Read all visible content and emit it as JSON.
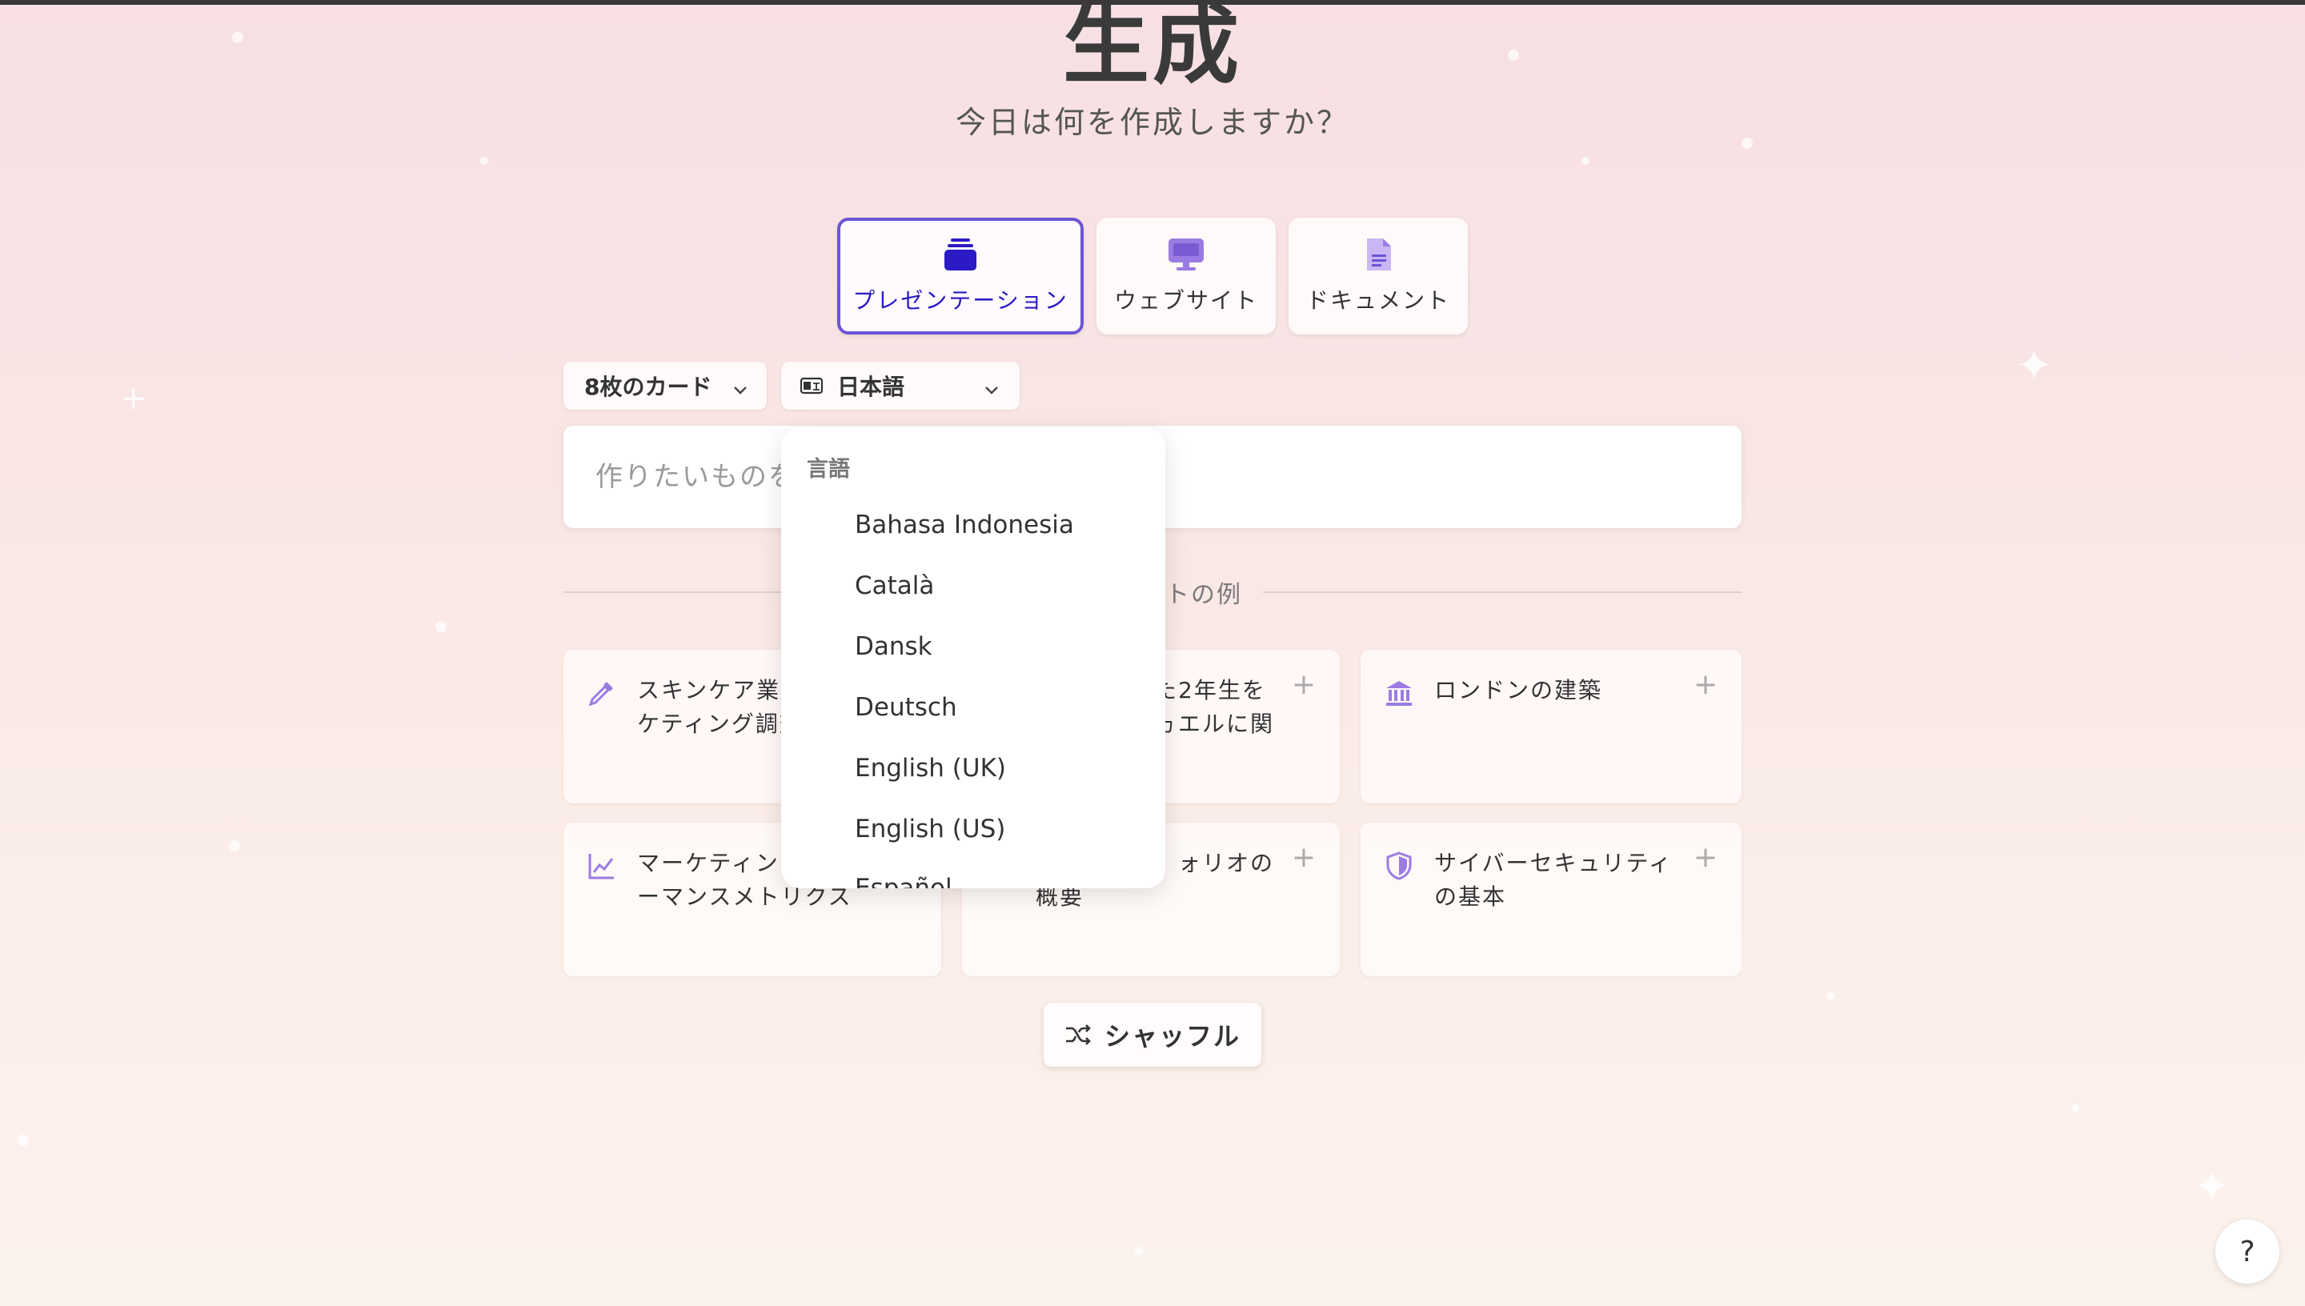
{
  "page": {
    "title": "生成",
    "subtitle": "今日は何を作成しますか？"
  },
  "types": [
    {
      "label": "プレゼンテーション",
      "icon": "slides-stack-icon",
      "selected": true
    },
    {
      "label": "ウェブサイト",
      "icon": "monitor-icon",
      "selected": false
    },
    {
      "label": "ドキュメント",
      "icon": "document-icon",
      "selected": false
    }
  ],
  "controls": {
    "cards_label": "8枚のカード",
    "language_label": "日本語"
  },
  "prompt": {
    "placeholder": "作りたいものを"
  },
  "divider": {
    "label": "トの例"
  },
  "examples": [
    {
      "text": "スキンケア業界のマーケティング調査",
      "icon": "pipette-icon"
    },
    {
      "text": "2年生をエルに関",
      "icon": "plus-icon"
    },
    {
      "text": "ロンドンの建築",
      "icon": "bank-icon"
    },
    {
      "text": "マーケティングのパフォーマンスメトリクス",
      "icon": "line-chart-icon"
    },
    {
      "text": "ォリオの概要",
      "icon": "plus-icon"
    },
    {
      "text": "サイバーセキュリティの基本",
      "icon": "shield-icon"
    }
  ],
  "example_texts": {
    "card1_line1": "スキンケア業界",
    "card1_line2": "ケティング調査",
    "card2_line1": "た2年生を",
    "card2_line2": "ヵエルに関",
    "card3_line1": "ロンドンの建築",
    "card4_line1": "マーケティング",
    "card4_line2": "ーマンスメトリクス",
    "card5_line1": "ォリオの",
    "card5_line2": "概要",
    "card6_line1": "サイバーセキュリティ",
    "card6_line2": "の基本"
  },
  "shuffle": {
    "label": "シャッフル"
  },
  "language_dropdown": {
    "header": "言語",
    "items": [
      "Bahasa Indonesia",
      "Català",
      "Dansk",
      "Deutsch",
      "English (UK)",
      "English (US)",
      "Español"
    ]
  },
  "help": {
    "label": "?"
  },
  "colors": {
    "accent": "#6b55d6",
    "accent_text": "#2b1ac6",
    "icon_purple": "#9b7be3"
  }
}
